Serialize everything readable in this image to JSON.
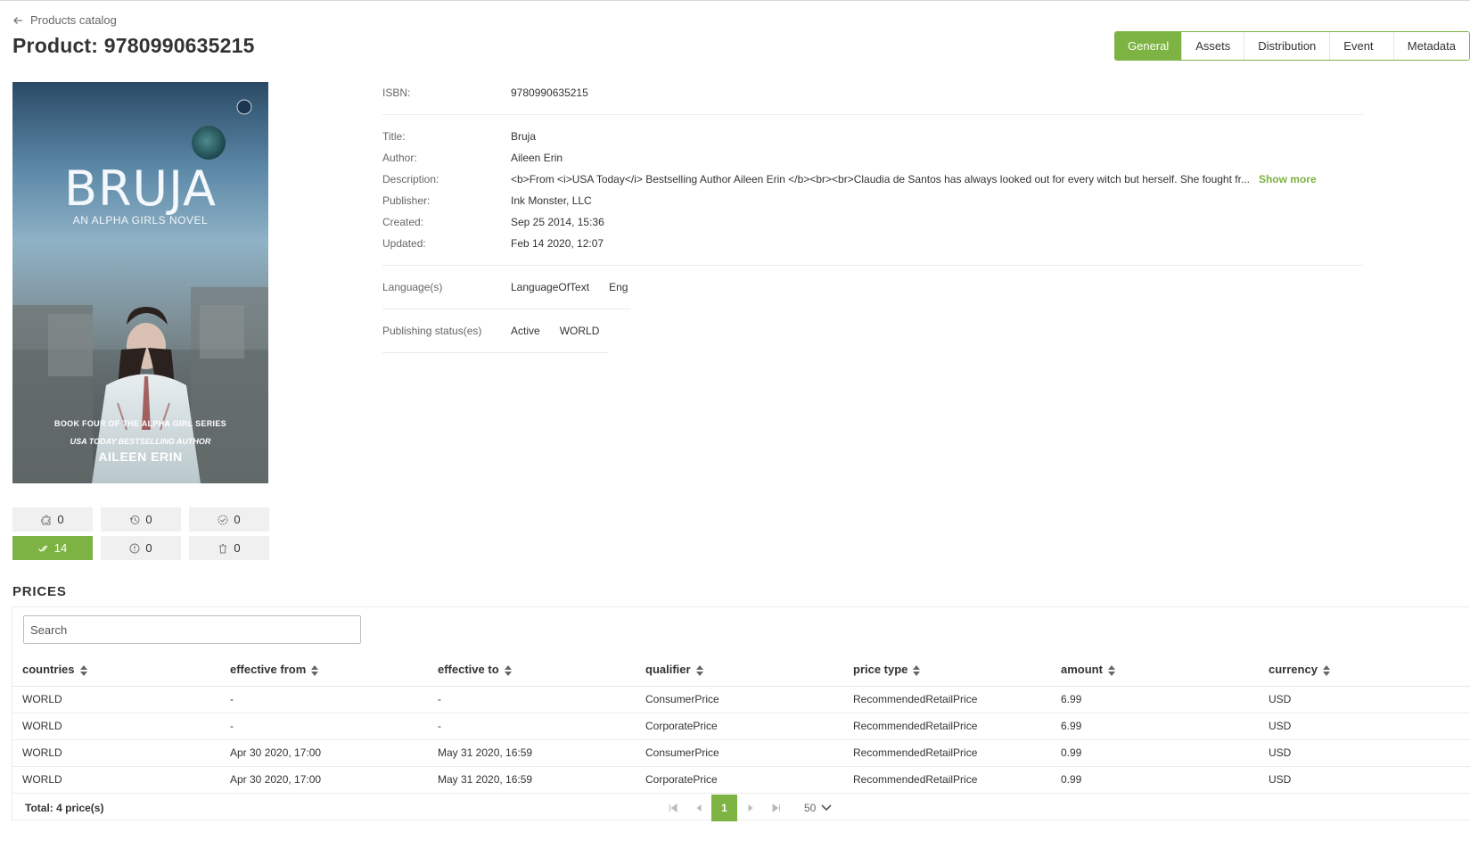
{
  "nav": {
    "back_label": "Products catalog"
  },
  "page": {
    "title": "Product: 9780990635215"
  },
  "tabs": [
    {
      "label": "General",
      "active": true
    },
    {
      "label": "Assets"
    },
    {
      "label": "Distribution"
    },
    {
      "label": "Event log"
    },
    {
      "label": "Metadata"
    }
  ],
  "cover": {
    "title": "BRUJA",
    "subtitle": "AN ALPHA GIRLS NOVEL",
    "series": "BOOK FOUR OF THE ALPHA GIRL SERIES",
    "author_tag": "USA TODAY BESTSELLING AUTHOR",
    "author": "AILEEN ERIN"
  },
  "counters": [
    {
      "icon": "puzzle-icon",
      "value": "0"
    },
    {
      "icon": "history-icon",
      "value": "0"
    },
    {
      "icon": "check-circle-icon",
      "value": "0"
    },
    {
      "icon": "double-check-icon",
      "value": "14"
    },
    {
      "icon": "alert-icon",
      "value": "0"
    },
    {
      "icon": "trash-icon",
      "value": "0"
    }
  ],
  "details": {
    "isbn_label": "ISBN:",
    "isbn": "9780990635215",
    "title_label": "Title:",
    "title": "Bruja",
    "author_label": "Author:",
    "author": "Aileen Erin",
    "description_label": "Description:",
    "description": "<b>From <i>USA Today</i> Bestselling Author Aileen Erin </b><br><br>Claudia de Santos has always looked out for every witch but herself. She fought fr...",
    "show_more": "Show more",
    "publisher_label": "Publisher:",
    "publisher": "Ink Monster, LLC",
    "created_label": "Created:",
    "created": "Sep 25 2014, 15:36",
    "updated_label": "Updated:",
    "updated": "Feb 14 2020, 12:07",
    "language_label": "Language(s)",
    "language_type": "LanguageOfText",
    "language_value": "Eng",
    "status_label": "Publishing status(es)",
    "status": "Active",
    "status_region": "WORLD"
  },
  "prices": {
    "heading": "PRICES",
    "search_placeholder": "Search",
    "columns": [
      "countries",
      "effective from",
      "effective to",
      "qualifier",
      "price type",
      "amount",
      "currency"
    ],
    "rows": [
      [
        "WORLD",
        "-",
        "-",
        "ConsumerPrice",
        "RecommendedRetailPrice",
        "6.99",
        "USD"
      ],
      [
        "WORLD",
        "-",
        "-",
        "CorporatePrice",
        "RecommendedRetailPrice",
        "6.99",
        "USD"
      ],
      [
        "WORLD",
        "Apr 30 2020, 17:00",
        "May 31 2020, 16:59",
        "ConsumerPrice",
        "RecommendedRetailPrice",
        "0.99",
        "USD"
      ],
      [
        "WORLD",
        "Apr 30 2020, 17:00",
        "May 31 2020, 16:59",
        "CorporatePrice",
        "RecommendedRetailPrice",
        "0.99",
        "USD"
      ]
    ],
    "total": "Total: 4 price(s)",
    "current_page": "1",
    "per_page": "50"
  },
  "colors": {
    "accent": "#7cb342"
  }
}
